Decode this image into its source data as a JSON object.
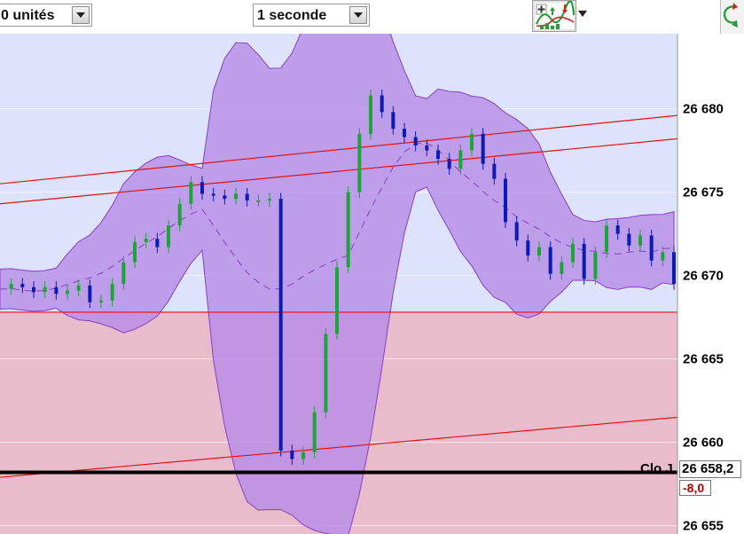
{
  "toolbar": {
    "units_value": "0 unités",
    "interval_value": "1 seconde",
    "indicator_icon": "chart-indicator-icon",
    "corner_icon": "refresh-icon"
  },
  "axis": {
    "ticks": [
      "26 680",
      "26 675",
      "26 670",
      "26 665",
      "26 660",
      "26 655"
    ]
  },
  "overlay": {
    "clo_label": "Clo J",
    "price_label": "26 658,2",
    "change_label": "-8,0"
  },
  "colors": {
    "upper_zone": "#dde3fb",
    "lower_zone": "#e9bccb",
    "band_fill": "#b68be6",
    "band_edge": "#8a3fc2",
    "line_red": "#e01414",
    "candle_up": "#1fa43a",
    "candle_down": "#0c1ab8",
    "change_text": "#b00000"
  },
  "chart_data": {
    "type": "candlestick",
    "y_unit": "index points",
    "ylim": [
      26654.5,
      26684.5
    ],
    "close_reference": 26658.2,
    "change": -8.0,
    "horizontal_levels": [
      26667.8
    ],
    "trend_lines": [
      {
        "start": 26675.5,
        "end": 26679.6
      },
      {
        "start": 26674.3,
        "end": 26678.2
      },
      {
        "start": 26657.9,
        "end": 26661.5
      }
    ],
    "price_path": [
      26669.2,
      26669.5,
      26669.3,
      26669.0,
      26669.3,
      26668.9,
      26669.1,
      26669.4,
      26668.4,
      26668.5,
      26669.5,
      26670.8,
      26672.0,
      26672.2,
      26671.7,
      26673.0,
      26674.3,
      26675.6,
      26674.9,
      26674.8,
      26674.6,
      26674.9,
      26674.5,
      26674.5,
      26674.6,
      26659.5,
      26659.0,
      26659.4,
      26661.8,
      26666.5,
      26670.5,
      26675.0,
      26678.5,
      26680.8,
      26679.8,
      26678.8,
      26678.3,
      26677.8,
      26677.5,
      26677.0,
      26676.4,
      26677.5,
      26678.5,
      26676.7,
      26675.8,
      26673.2,
      26672.1,
      26671.2,
      26671.7,
      26670.1,
      26670.8,
      26671.9,
      26669.8,
      26671.4,
      26673.0,
      26672.5,
      26671.8,
      26672.4,
      26670.9,
      26671.4,
      26669.5
    ]
  }
}
